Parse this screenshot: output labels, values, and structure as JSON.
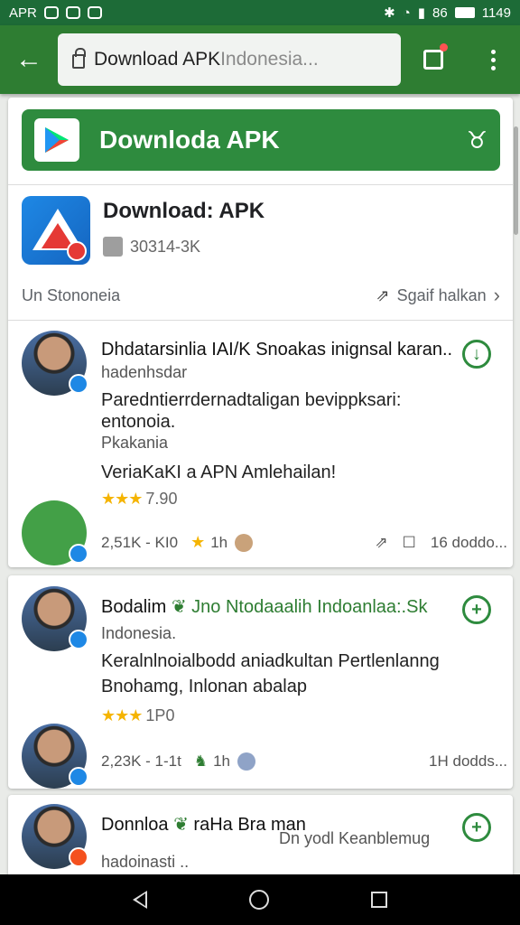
{
  "status_bar": {
    "carrier": "APR",
    "battery_text": "86",
    "time": "1149"
  },
  "toolbar": {
    "url_text": "Download APK",
    "url_dim_text": "Indonesia..."
  },
  "banner": {
    "title": "Downloda APK"
  },
  "app": {
    "name": "Download: APK",
    "meta": "30314-3K"
  },
  "region": {
    "left_label": "Un Stononeia",
    "right_label": "Sgaif halkan"
  },
  "posts": [
    {
      "title": "Dhdatarsinlia IAI/K Snoakas inignsal karan..",
      "subtitle": "hadenhsdar",
      "body_line1": "Paredntierrdernadtaligan bevippksari:",
      "body_line2": "entonoia.",
      "body_line3": "Pkakania",
      "body_line4": "VeriaKaKI a APN Amlehailan!",
      "rating": "7.90",
      "views": "2,51K - KI0",
      "likes": "1h",
      "comments": "16 doddo..."
    },
    {
      "title_black": "Bodalim",
      "title_green": "Jno Ntodaaalih Indoanlaa:.Sk",
      "subtitle": "Indonesia.",
      "body_line1": "Keralnlnoialbodd aniadkultan Pertlenlanng",
      "body_line2": "Bnohamg, Inlonan abalap",
      "rating": "1P0",
      "views": "2,23K - 1-1t",
      "likes": "1h",
      "comments": "1H dodds..."
    },
    {
      "title": "Donnloa",
      "title_part2": "raHa Bra man",
      "subtitle_right": "Dn yodl Keanblemug",
      "subtitle": "hadoinasti .."
    }
  ]
}
